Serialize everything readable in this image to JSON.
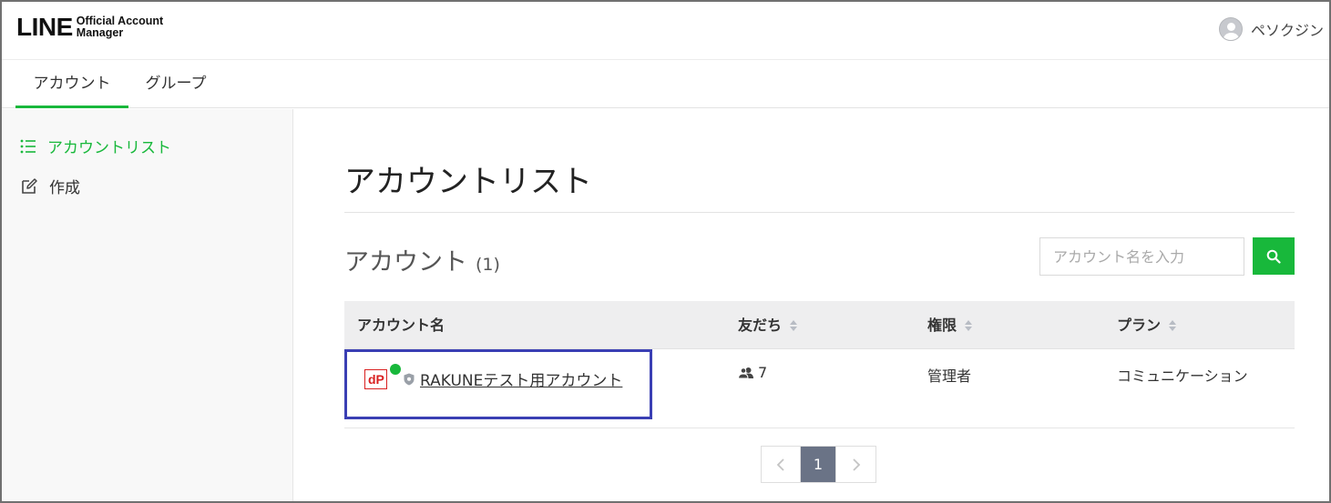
{
  "header": {
    "logo_text": "LINE",
    "logo_sub_line1": "Official Account",
    "logo_sub_line2": "Manager",
    "user_name": "ペソクジン"
  },
  "tabs": [
    {
      "label": "アカウント",
      "active": true
    },
    {
      "label": "グループ",
      "active": false
    }
  ],
  "sidebar": {
    "items": [
      {
        "label": "アカウントリスト",
        "icon": "list-icon",
        "active": true
      },
      {
        "label": "作成",
        "icon": "edit-icon",
        "active": false
      }
    ]
  },
  "main": {
    "page_title": "アカウントリスト",
    "section_title": "アカウント",
    "section_count": "(1)",
    "search": {
      "placeholder": "アカウント名を入力",
      "value": ""
    },
    "table": {
      "headers": [
        "アカウント名",
        "友だち",
        "権限",
        "プラン"
      ],
      "rows": [
        {
          "name": "RAKUNEテスト用アカウント",
          "friends": "7",
          "role": "管理者",
          "plan": "コミュニケーション"
        }
      ]
    },
    "pagination": {
      "prev": "‹",
      "current": "1",
      "next": "›"
    }
  },
  "colors": {
    "accent_green": "#18b83b",
    "highlight_blue": "#3a3fb4",
    "account_logo_red": "#d92020",
    "pagination_active": "#6a7386"
  }
}
